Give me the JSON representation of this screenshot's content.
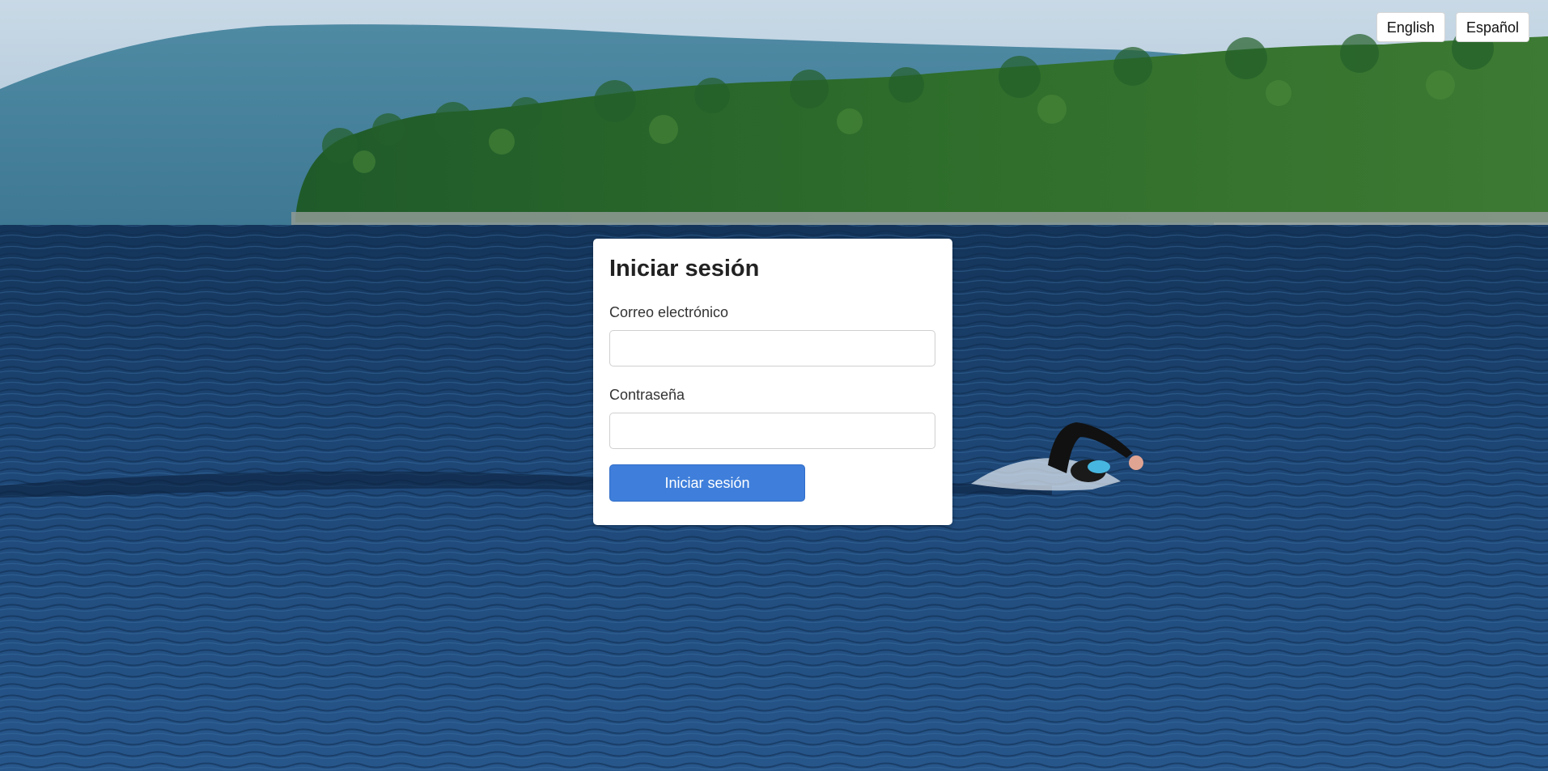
{
  "language_switch": {
    "english_label": "English",
    "spanish_label": "Español"
  },
  "login": {
    "title": "Iniciar sesión",
    "email_label": "Correo electrónico",
    "email_value": "",
    "password_label": "Contraseña",
    "password_value": "",
    "submit_label": "Iniciar sesión"
  },
  "colors": {
    "primary_button": "#3f7fdb",
    "card_background": "#ffffff",
    "water": "#1d3f68",
    "forest": "#2f6a2a",
    "sky": "#b9cfe0"
  },
  "background": {
    "description_icon": "lake-swimmer-photo"
  }
}
